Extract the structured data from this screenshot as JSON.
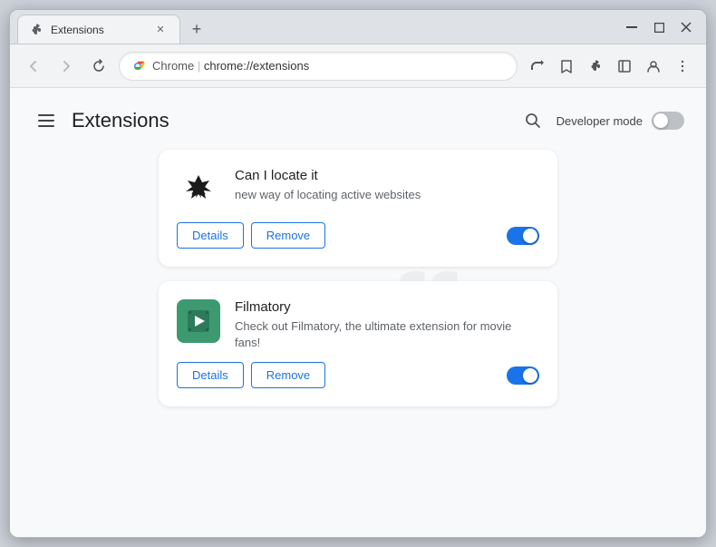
{
  "window": {
    "title": "Extensions",
    "controls": {
      "minimize": "—",
      "maximize": "□",
      "close": "✕"
    }
  },
  "tab": {
    "favicon_alt": "extensions-favicon",
    "title": "Extensions",
    "close_label": "✕"
  },
  "new_tab_button": "+",
  "address_bar": {
    "brand": "Chrome",
    "url": "chrome://extensions",
    "back_title": "Back",
    "forward_title": "Forward",
    "reload_title": "Reload"
  },
  "page": {
    "title": "Extensions",
    "developer_mode_label": "Developer mode",
    "search_title": "Search extensions"
  },
  "extensions": [
    {
      "id": "can-i-locate-it",
      "name": "Can I locate it",
      "description": "new way of locating active websites",
      "enabled": true,
      "details_label": "Details",
      "remove_label": "Remove"
    },
    {
      "id": "filmatory",
      "name": "Filmatory",
      "description": "Check out Filmatory, the ultimate extension for movie fans!",
      "enabled": true,
      "details_label": "Details",
      "remove_label": "Remove"
    }
  ]
}
